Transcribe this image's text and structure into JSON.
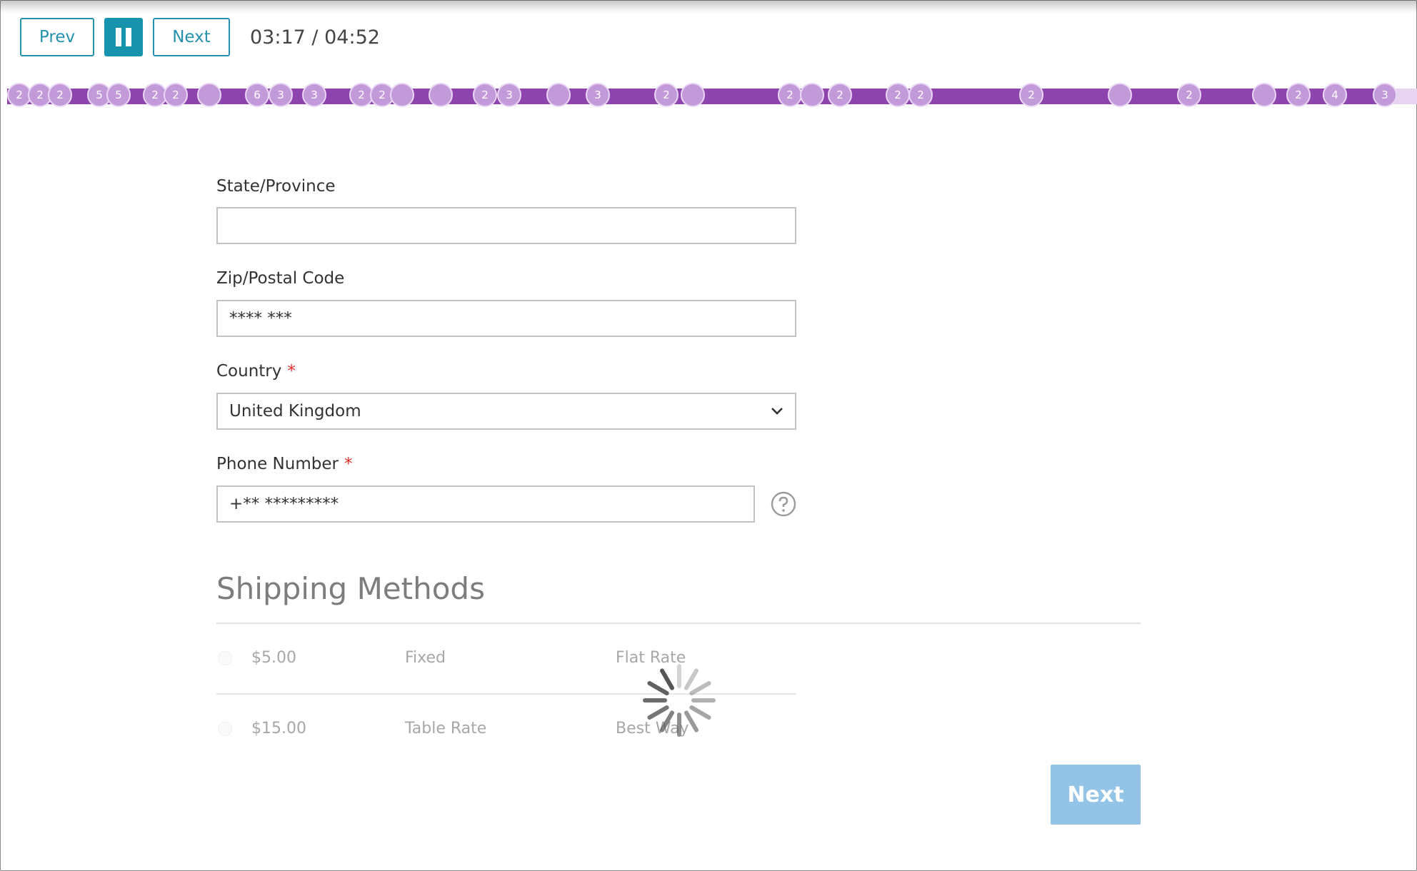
{
  "player": {
    "prev_label": "Prev",
    "next_label": "Next",
    "current_time": "03:17",
    "separator": "/",
    "total_time": "04:52"
  },
  "timeline": {
    "markers": [
      "2",
      "2",
      "2",
      "5",
      "5",
      "2",
      "2",
      "",
      "6",
      "3",
      "3",
      "2",
      "2",
      "",
      "",
      "2",
      "3",
      "",
      "3",
      "2",
      "",
      "2",
      "",
      "2",
      "2",
      "2",
      "2",
      "",
      "2",
      "",
      "2",
      "",
      "4",
      "3"
    ],
    "colors": {
      "track": "#8e44ad",
      "marker": "#c39ad9"
    }
  },
  "form": {
    "state": {
      "label": "State/Province",
      "value": ""
    },
    "zip": {
      "label": "Zip/Postal Code",
      "value": "**** ***"
    },
    "country": {
      "label": "Country",
      "required_mark": "*",
      "value": "United Kingdom"
    },
    "phone": {
      "label": "Phone Number",
      "required_mark": "*",
      "value": "+** *********"
    }
  },
  "shipping": {
    "title": "Shipping Methods",
    "methods": [
      {
        "price": "$5.00",
        "method": "Fixed",
        "carrier": "Flat Rate"
      },
      {
        "price": "$15.00",
        "method": "Table Rate",
        "carrier": "Best Way"
      }
    ]
  },
  "actions": {
    "next_label": "Next"
  },
  "colors": {
    "accent": "#1793ad",
    "required": "#e02b27",
    "next_button": "#93c3e7"
  }
}
